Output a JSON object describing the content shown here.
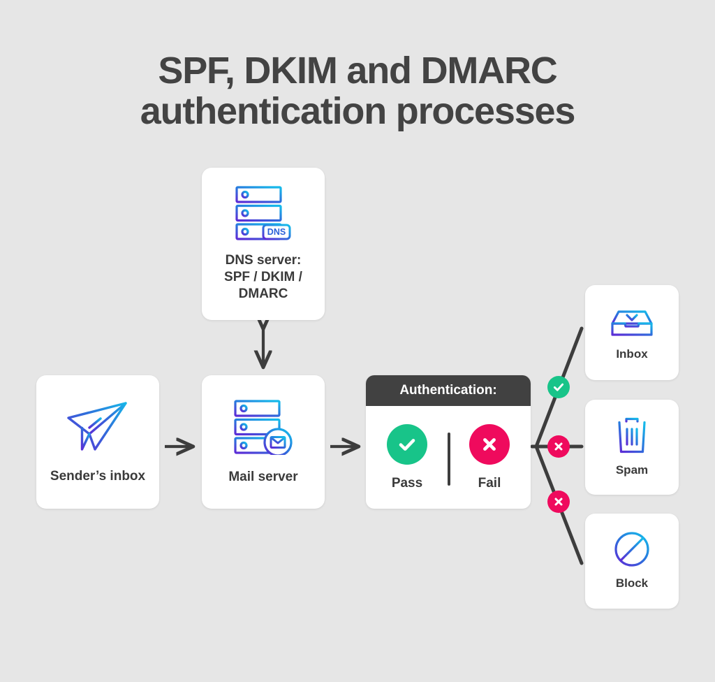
{
  "title": "SPF, DKIM and DMARC\nauthentication processes",
  "colors": {
    "background": "#e6e6e6",
    "card_background": "#ffffff",
    "text_dark": "#3a3a3a",
    "header_dark": "#414141",
    "pass_green": "#18c489",
    "fail_pink": "#ef0a5d",
    "icon_gradient_start": "#5b2ed6",
    "icon_gradient_end": "#18b6e8",
    "connector": "#3d3d3d"
  },
  "nodes": {
    "dns_server": {
      "label": "DNS server:\nSPF / DKIM /\nDMARC",
      "icon": "dns-server-icon",
      "badge_text": "DNS"
    },
    "sender_inbox": {
      "label": "Sender’s inbox",
      "icon": "paper-plane-icon"
    },
    "mail_server": {
      "label": "Mail server",
      "icon": "mail-server-icon"
    },
    "inbox": {
      "label": "Inbox",
      "icon": "inbox-tray-icon"
    },
    "spam": {
      "label": "Spam",
      "icon": "trash-can-icon"
    },
    "block": {
      "label": "Block",
      "icon": "block-circle-icon"
    }
  },
  "authentication": {
    "header": "Authentication:",
    "pass": {
      "label": "Pass",
      "icon": "check-circle-icon",
      "color": "#18c489"
    },
    "fail": {
      "label": "Fail",
      "icon": "x-circle-icon",
      "color": "#ef0a5d"
    }
  },
  "branches": [
    {
      "target": "Inbox",
      "verdict": "pass",
      "icon": "check-badge-icon",
      "color": "#18c489"
    },
    {
      "target": "Spam",
      "verdict": "fail",
      "icon": "x-badge-icon",
      "color": "#ef0a5d"
    },
    {
      "target": "Block",
      "verdict": "fail",
      "icon": "x-badge-icon",
      "color": "#ef0a5d"
    }
  ],
  "connectors": [
    {
      "name": "sender-to-mail",
      "style": "single-arrow-right"
    },
    {
      "name": "mail-to-auth",
      "style": "single-arrow-right"
    },
    {
      "name": "dns-to-mail",
      "style": "double-arrow-vertical"
    },
    {
      "name": "auth-to-inbox",
      "style": "diagonal-up"
    },
    {
      "name": "auth-to-spam",
      "style": "horizontal"
    },
    {
      "name": "auth-to-block",
      "style": "diagonal-down"
    }
  ]
}
